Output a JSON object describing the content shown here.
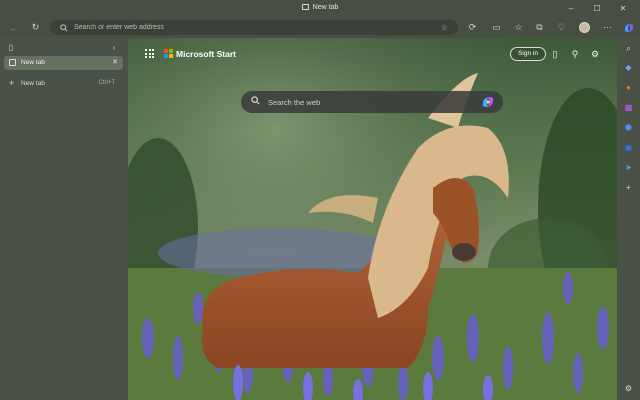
{
  "window": {
    "title": "New tab"
  },
  "toolbar": {
    "address_placeholder": "Search or enter web address"
  },
  "vertical_tabs": {
    "tabs": [
      {
        "label": "New tab",
        "close": "✕"
      }
    ],
    "new_tab": {
      "label": "New tab",
      "shortcut": "Ctrl+T"
    }
  },
  "start_page": {
    "brand": "Microsoft Start",
    "sign_in_label": "Sign in",
    "search_placeholder": "Search the web"
  },
  "colors": {
    "ms_red": "#f25022",
    "ms_green": "#7fba00",
    "ms_blue": "#00a4ef",
    "ms_yellow": "#ffb900"
  }
}
